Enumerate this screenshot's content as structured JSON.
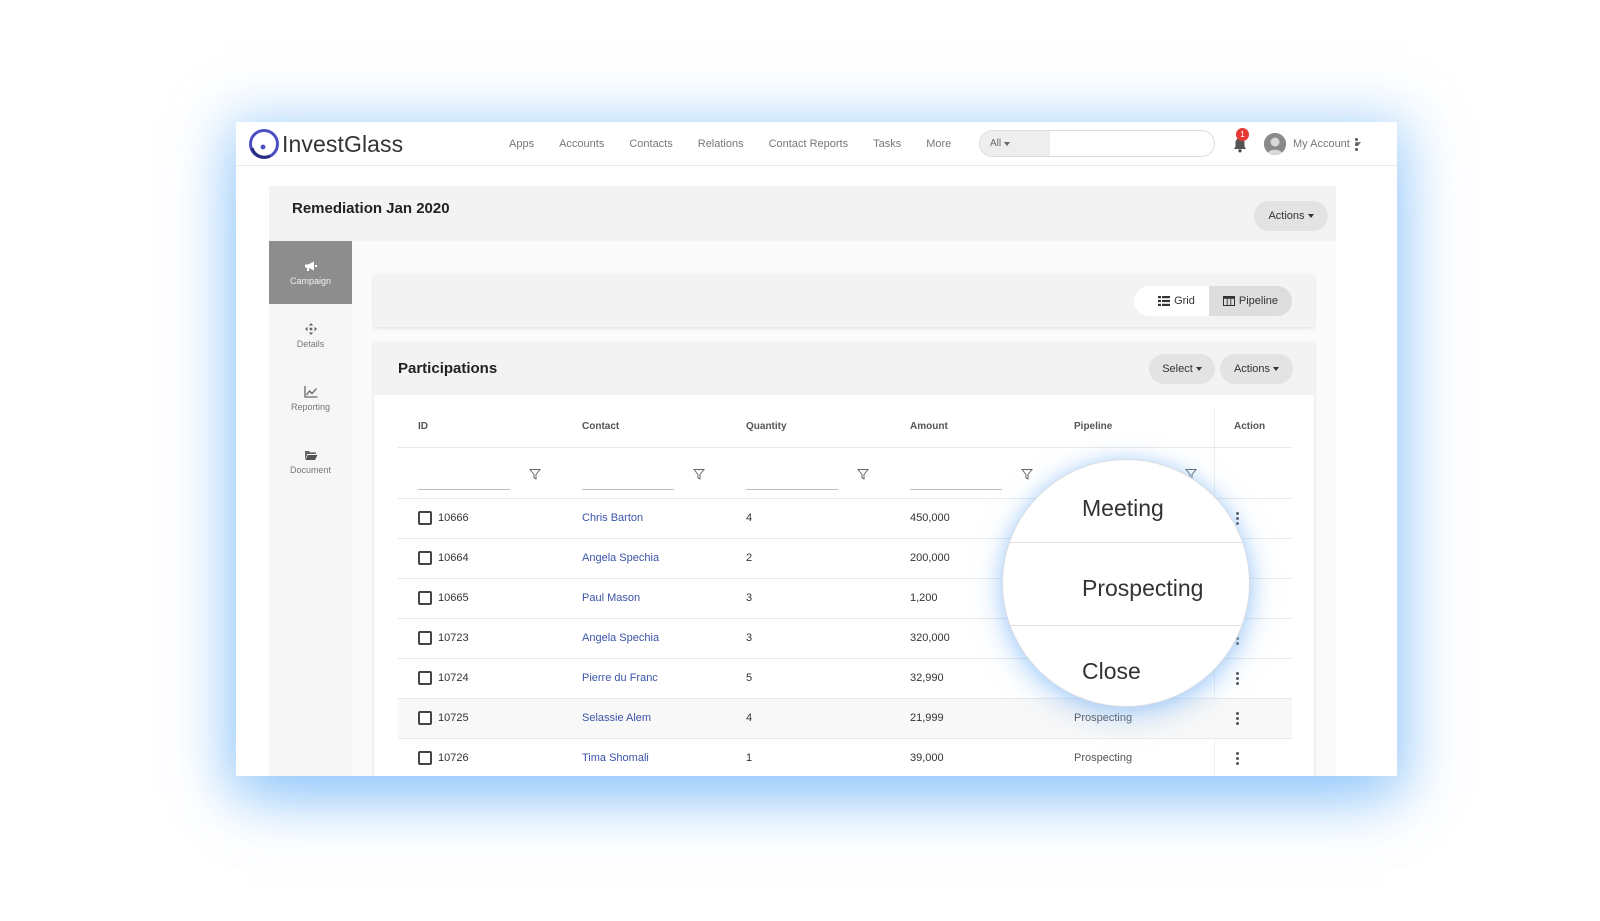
{
  "brand": {
    "name": "InvestGlass",
    "accent": "#4a4fc4"
  },
  "nav": {
    "links": [
      "Apps",
      "Accounts",
      "Contacts",
      "Relations",
      "Contact Reports",
      "Tasks",
      "More"
    ],
    "search_scope": "All",
    "search_placeholder": "",
    "notification_count": "1",
    "account_label": "My Account"
  },
  "campaign": {
    "title": "Remediation Jan 2020",
    "actions_label": "Actions"
  },
  "sidebar": {
    "items": [
      {
        "label": "Campaign",
        "icon": "megaphone-icon",
        "active": true
      },
      {
        "label": "Details",
        "icon": "move-arrows-icon",
        "active": false
      },
      {
        "label": "Reporting",
        "icon": "line-chart-icon",
        "active": false
      },
      {
        "label": "Document",
        "icon": "folder-open-icon",
        "active": false
      }
    ]
  },
  "view_toggle": {
    "grid_label": "Grid",
    "pipeline_label": "Pipeline",
    "selected": "Pipeline"
  },
  "participations": {
    "title": "Participations",
    "select_label": "Select",
    "actions_label": "Actions",
    "columns": [
      "ID",
      "Contact",
      "Quantity",
      "Amount",
      "Pipeline",
      "Action"
    ],
    "rows": [
      {
        "id": "10666",
        "contact": "Chris Barton",
        "quantity": "4",
        "amount": "450,000",
        "pipeline": ""
      },
      {
        "id": "10664",
        "contact": "Angela Spechia",
        "quantity": "2",
        "amount": "200,000",
        "pipeline": ""
      },
      {
        "id": "10665",
        "contact": "Paul Mason",
        "quantity": "3",
        "amount": "1,200",
        "pipeline": ""
      },
      {
        "id": "10723",
        "contact": "Angela Spechia",
        "quantity": "3",
        "amount": "320,000",
        "pipeline": ""
      },
      {
        "id": "10724",
        "contact": "Pierre du Franc",
        "quantity": "5",
        "amount": "32,990",
        "pipeline": ""
      },
      {
        "id": "10725",
        "contact": "Selassie Alem",
        "quantity": "4",
        "amount": "21,999",
        "pipeline": "Prospecting"
      },
      {
        "id": "10726",
        "contact": "Tima Shomali",
        "quantity": "1",
        "amount": "39,000",
        "pipeline": "Prospecting"
      }
    ]
  },
  "pipeline_zoom": {
    "options": [
      "Meeting",
      "Prospecting",
      "Close"
    ]
  }
}
